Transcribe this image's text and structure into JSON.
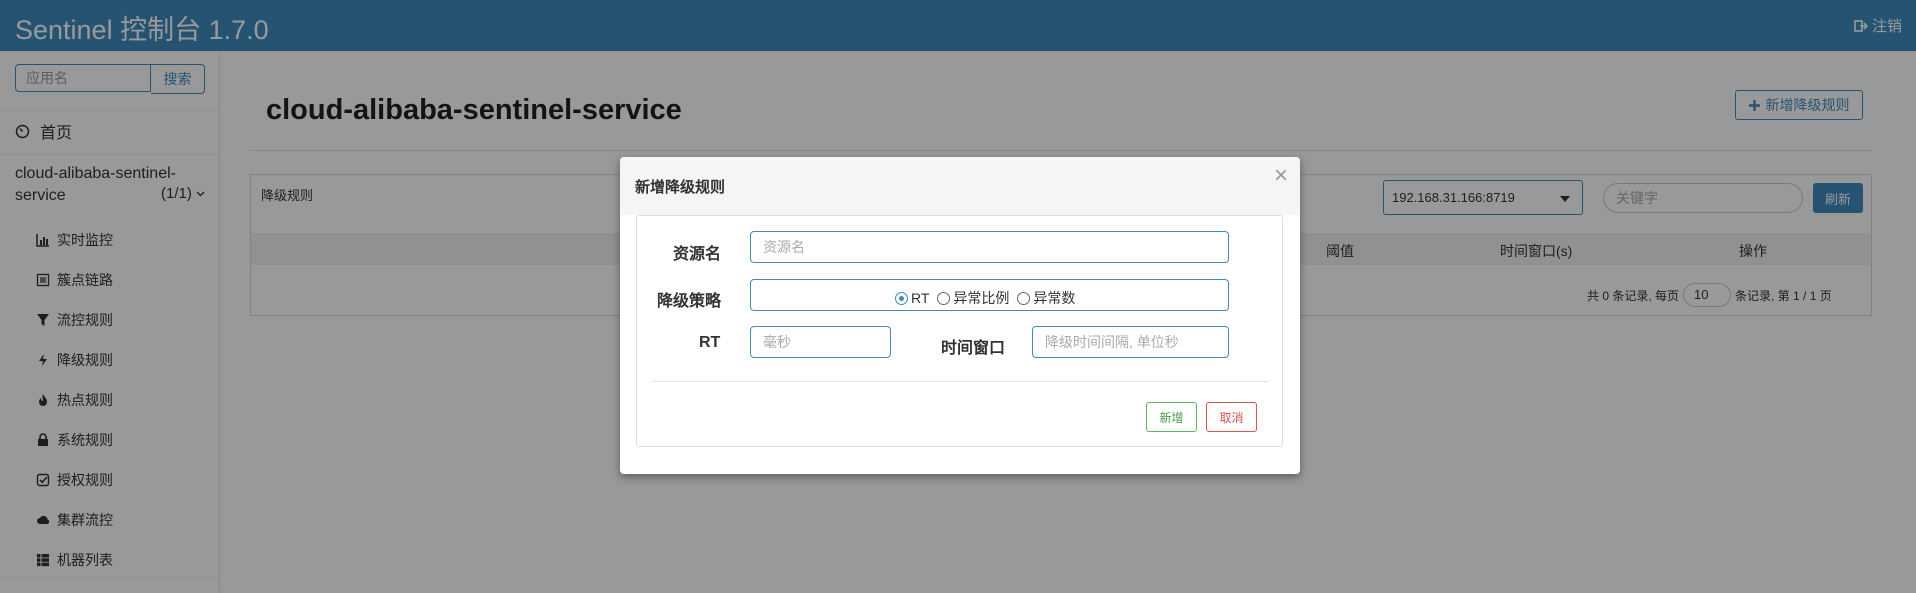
{
  "header": {
    "brand": "Sentinel 控制台 1.7.0",
    "logout_label": "注销"
  },
  "sidebar": {
    "search_placeholder": "应用名",
    "search_button": "搜索",
    "home_label": "首页",
    "app": {
      "name": "cloud-alibaba-sentinel-service",
      "count": "(1/1)"
    },
    "menu": [
      {
        "label": "实时监控",
        "icon": "bar-chart-icon"
      },
      {
        "label": "簇点链路",
        "icon": "list-icon"
      },
      {
        "label": "流控规则",
        "icon": "filter-icon"
      },
      {
        "label": "降级规则",
        "icon": "flash-icon"
      },
      {
        "label": "热点规则",
        "icon": "fire-icon"
      },
      {
        "label": "系统规则",
        "icon": "lock-icon"
      },
      {
        "label": "授权规则",
        "icon": "check-icon"
      },
      {
        "label": "集群流控",
        "icon": "cloud-icon"
      },
      {
        "label": "机器列表",
        "icon": "th-list-icon"
      }
    ]
  },
  "main": {
    "title": "cloud-alibaba-sentinel-service",
    "add_button": "新增降级规则",
    "panel": {
      "title": "降级规则",
      "machine": "192.168.31.166:8719",
      "keyword_placeholder": "关键字",
      "refresh_button": "刷新",
      "columns": [
        "阈值",
        "时间窗口(s)",
        "操作"
      ],
      "pager": {
        "prefix": "共 0 条记录, 每页",
        "page_size": "10",
        "suffix": "条记录, 第 1 / 1 页"
      }
    }
  },
  "modal": {
    "title": "新增降级规则",
    "close": "×",
    "resource_label": "资源名",
    "resource_placeholder": "资源名",
    "strategy_label": "降级策略",
    "strategy_options": [
      "RT",
      "异常比例",
      "异常数"
    ],
    "strategy_selected": "RT",
    "rt_label": "RT",
    "rt_placeholder": "毫秒",
    "window_label": "时间窗口",
    "window_placeholder": "降级时间间隔, 单位秒",
    "ok_button": "新增",
    "cancel_button": "取消"
  },
  "colors": {
    "primary": "#3c8dbc",
    "success": "#5cb85c",
    "danger": "#d9534f"
  }
}
